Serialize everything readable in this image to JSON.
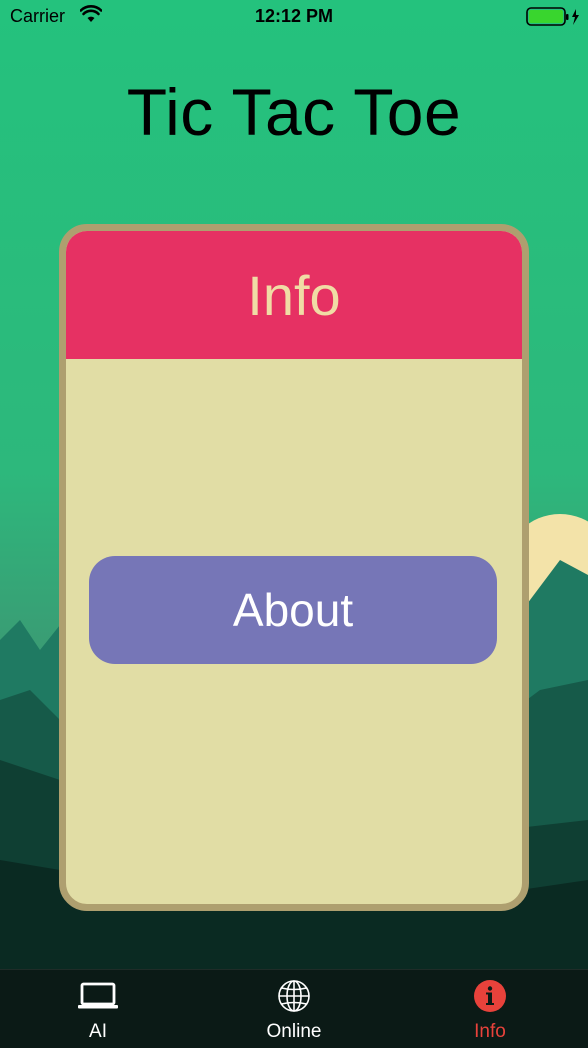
{
  "status_bar": {
    "carrier": "Carrier",
    "time": "12:12 PM"
  },
  "app": {
    "title": "Tic Tac Toe"
  },
  "card": {
    "header": "Info",
    "about_button": "About"
  },
  "tabs": [
    {
      "label": "AI",
      "icon": "laptop-icon",
      "active": false
    },
    {
      "label": "Online",
      "icon": "globe-icon",
      "active": false
    },
    {
      "label": "Info",
      "icon": "info-icon",
      "active": true
    }
  ],
  "colors": {
    "sky": "#24c27d",
    "card_border": "#ae9f6f",
    "card_body": "#e1dda5",
    "card_header": "#e63163",
    "header_text": "#f0dca5",
    "button": "#7676b7",
    "tabbar": "#0b1a16",
    "active_tab": "#e8423b"
  }
}
